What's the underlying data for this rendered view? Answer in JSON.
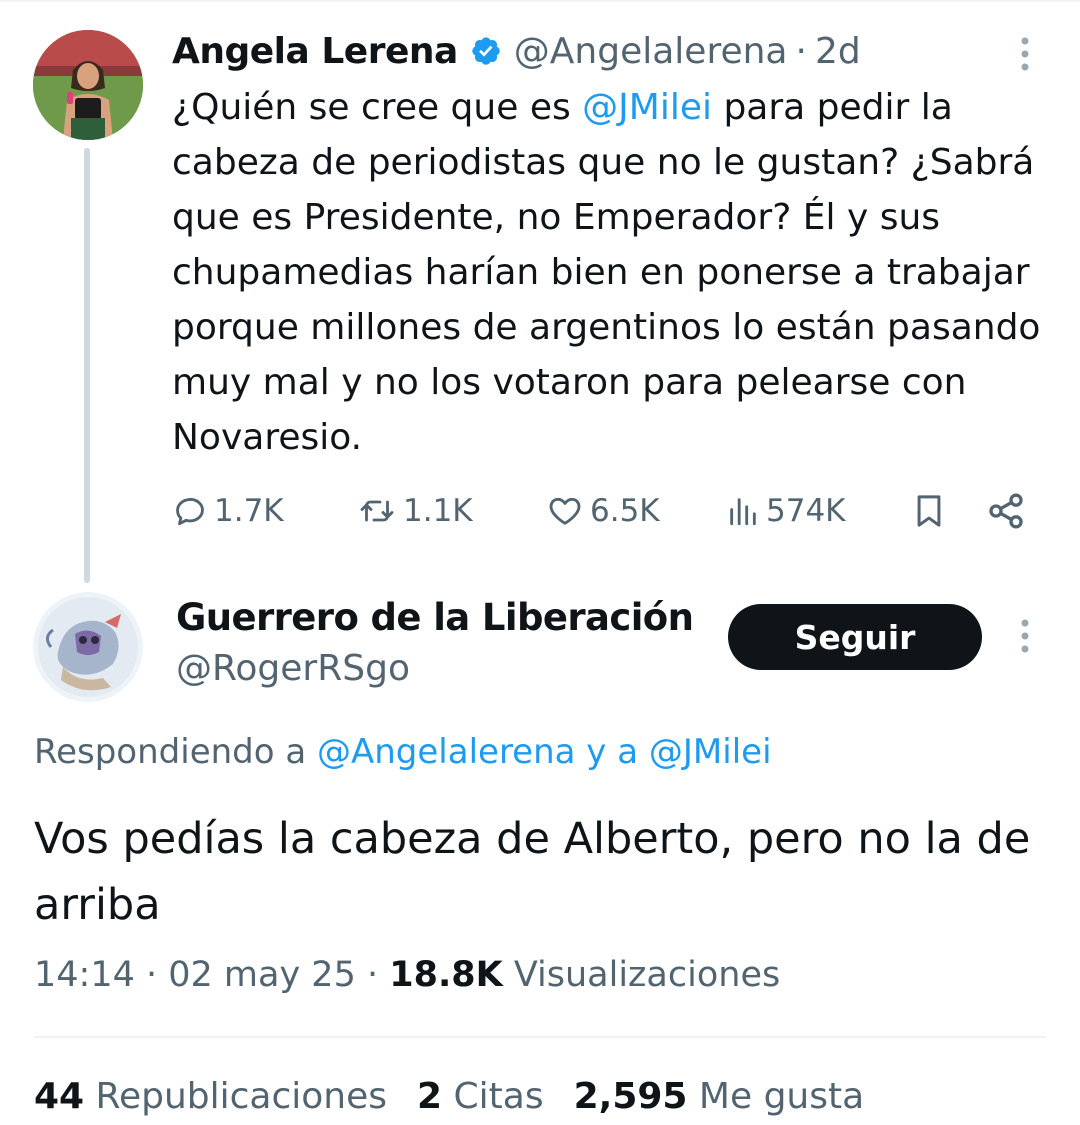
{
  "parent_tweet": {
    "author_name": "Angela Lerena",
    "handle": "@Angelalerena",
    "separator": "·",
    "time_ago": "2d",
    "text_parts": {
      "p1": "¿Quién se cree que es ",
      "mention": "@JMilei",
      "p2": " para pedir la cabeza de periodistas que no le gustan? ¿Sabrá que es Presidente, no Emperador? Él y sus chupamedias harían bien en ponerse a trabajar porque millones de argentinos lo están pasando muy mal y no los votaron para pelearse con Novaresio."
    },
    "actions": {
      "replies": "1.7K",
      "reposts": "1.1K",
      "likes": "6.5K",
      "views": "574K"
    }
  },
  "reply_tweet": {
    "author_name": "Guerrero de la Liberación",
    "handle": "@RogerRSgo",
    "follow_label": "Seguir",
    "replying_to": {
      "prefix": "Respondiendo a ",
      "user1": "@Angelalerena",
      "conj": " y a ",
      "user2": "@JMilei"
    },
    "text": "Vos pedías la cabeza de Alberto, pero no la de arriba",
    "time": "14:14",
    "sep": " · ",
    "date": "02 may 25",
    "views_count": "18.8K",
    "views_label": " Visualizaciones"
  },
  "stats": {
    "reposts_count": "44",
    "reposts_label": " Republicaciones",
    "quotes_count": "2",
    "quotes_label": " Citas",
    "likes_count": "2,595",
    "likes_label": " Me gusta"
  },
  "colors": {
    "link": "#1d9bf0",
    "muted": "#536471",
    "text": "#0f1419",
    "button_bg": "#0f1419"
  },
  "icons": [
    "verified-badge-icon",
    "more-icon",
    "reply-icon",
    "repost-icon",
    "like-icon",
    "views-icon",
    "bookmark-icon",
    "share-icon"
  ]
}
